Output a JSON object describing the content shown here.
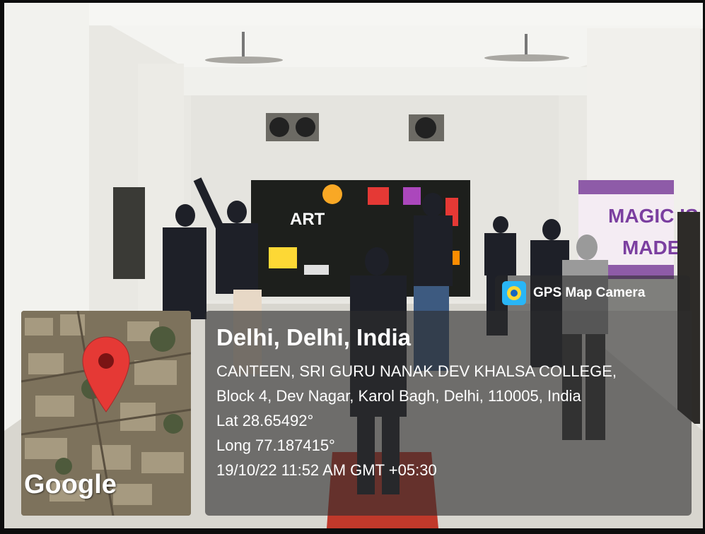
{
  "overlay": {
    "app_badge": "GPS Map Camera",
    "place_title": "Delhi, Delhi, India",
    "address_line1": "CANTEEN, SRI GURU NANAK DEV KHALSA COLLEGE,",
    "address_line2": "Block 4, Dev Nagar, Karol Bagh, Delhi, 110005, India",
    "latitude": "Lat 28.65492°",
    "longitude": "Long 77.187415°",
    "timestamp": "19/10/22 11:52 AM GMT +05:30",
    "map_brand": "Google"
  },
  "wall_banner": {
    "line1": "MAGIC IS",
    "line2": "MADE Y"
  },
  "art_wall": {
    "label": "ART"
  },
  "colors": {
    "pin_red": "#e53935",
    "badge_blue": "#29b6f6"
  }
}
